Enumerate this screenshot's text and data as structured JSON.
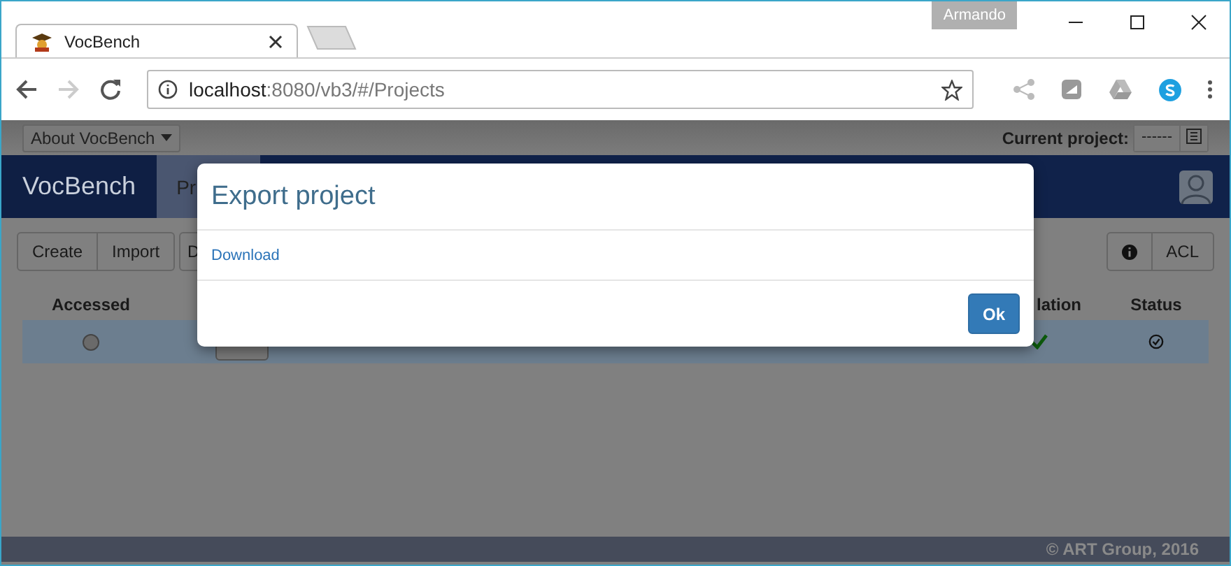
{
  "browser": {
    "tab_title": "VocBench",
    "profile": "Armando",
    "address_host": "localhost",
    "address_rest": ":8080/vb3/#/Projects",
    "forward_enabled": false
  },
  "page": {
    "about_menu": "About VocBench",
    "current_project_label": "Current project:",
    "current_project_value": "------",
    "brand": "VocBench",
    "nav_items": [
      {
        "label": "Pr",
        "selected": true
      }
    ],
    "toolbar_buttons": [
      {
        "label": "Create"
      },
      {
        "label": "Import"
      }
    ],
    "partial_button": "D",
    "right_button": "ACL",
    "columns": [
      "Accessed",
      "lation",
      "Status"
    ],
    "rows": [
      {
        "accessed": false,
        "selected": true,
        "validation": true
      }
    ],
    "footer": "© ART Group, 2016"
  },
  "dialog": {
    "title": "Export project",
    "link": "Download",
    "ok": "Ok"
  }
}
